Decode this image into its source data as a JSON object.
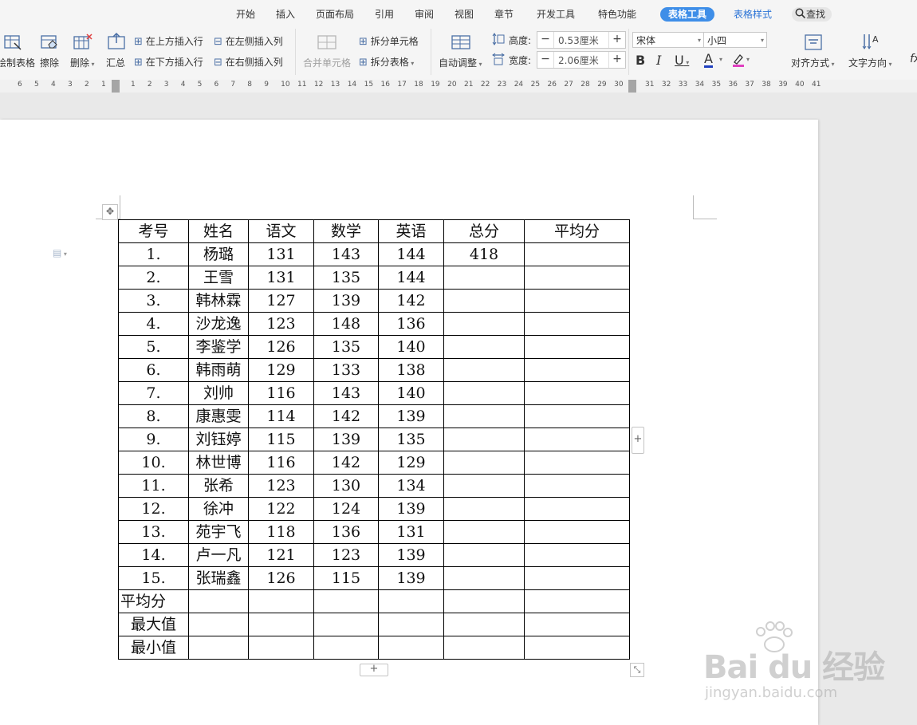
{
  "tabs": [
    "开始",
    "插入",
    "页面布局",
    "引用",
    "审阅",
    "视图",
    "章节",
    "开发工具",
    "特色功能",
    "表格工具",
    "表格样式"
  ],
  "search_label": "查找",
  "toolbar": {
    "draw_table": "绘制表格",
    "erase": "擦除",
    "delete": "删除",
    "summary": "汇总",
    "insert_above": "在上方插入行",
    "insert_below": "在下方插入行",
    "insert_left": "在左侧插入列",
    "insert_right": "在右侧插入列",
    "merge_cells": "合并单元格",
    "split_cells": "拆分单元格",
    "split_table": "拆分表格",
    "auto_fit": "自动调整",
    "height_label": "高度:",
    "height_value": "0.53厘米",
    "width_label": "宽度:",
    "width_value": "2.06厘米",
    "font_name": "宋体",
    "font_size": "小四",
    "bold": "B",
    "italic": "I",
    "underline": "U",
    "font_color": "A",
    "align": "对齐方式",
    "text_direction": "文字方向",
    "formula": "fx"
  },
  "ruler_left": [
    "6",
    "5",
    "4",
    "3",
    "2",
    "1"
  ],
  "ruler_right": [
    "1",
    "2",
    "3",
    "4",
    "5",
    "6",
    "7",
    "8",
    "9",
    "10",
    "11",
    "12",
    "13",
    "14",
    "15",
    "16",
    "17",
    "18",
    "19",
    "20",
    "21",
    "22",
    "23",
    "24",
    "25",
    "26",
    "27",
    "28",
    "29",
    "30",
    "31",
    "32",
    "33",
    "34",
    "35",
    "36",
    "37",
    "38",
    "39",
    "40",
    "41"
  ],
  "table": {
    "headers": [
      "考号",
      "姓名",
      "语文",
      "数学",
      "英语",
      "总分",
      "平均分"
    ],
    "rows": [
      [
        "1.",
        "杨璐",
        "131",
        "143",
        "144",
        "418",
        ""
      ],
      [
        "2.",
        "王雪",
        "131",
        "135",
        "144",
        "",
        ""
      ],
      [
        "3.",
        "韩林霖",
        "127",
        "139",
        "142",
        "",
        ""
      ],
      [
        "4.",
        "沙龙逸",
        "123",
        "148",
        "136",
        "",
        ""
      ],
      [
        "5.",
        "李鉴学",
        "126",
        "135",
        "140",
        "",
        ""
      ],
      [
        "6.",
        "韩雨萌",
        "129",
        "133",
        "138",
        "",
        ""
      ],
      [
        "7.",
        "刘帅",
        "116",
        "143",
        "140",
        "",
        ""
      ],
      [
        "8.",
        "康惠雯",
        "114",
        "142",
        "139",
        "",
        ""
      ],
      [
        "9.",
        "刘钰婷",
        "115",
        "139",
        "135",
        "",
        ""
      ],
      [
        "10.",
        "林世博",
        "116",
        "142",
        "129",
        "",
        ""
      ],
      [
        "11.",
        "张希",
        "123",
        "130",
        "134",
        "",
        ""
      ],
      [
        "12.",
        "徐冲",
        "122",
        "124",
        "139",
        "",
        ""
      ],
      [
        "13.",
        "苑宇飞",
        "118",
        "136",
        "131",
        "",
        ""
      ],
      [
        "14.",
        "卢一凡",
        "121",
        "123",
        "139",
        "",
        ""
      ],
      [
        "15.",
        "张瑞鑫",
        "126",
        "115",
        "139",
        "",
        ""
      ]
    ],
    "footer": [
      "平均分",
      "最大值",
      "最小值"
    ]
  },
  "watermark": {
    "brand": "Bai du 经验",
    "url": "jingyan.baidu.com"
  },
  "colors": {
    "accent": "#3e8ee8",
    "chinese_scores": "#f0a032"
  }
}
